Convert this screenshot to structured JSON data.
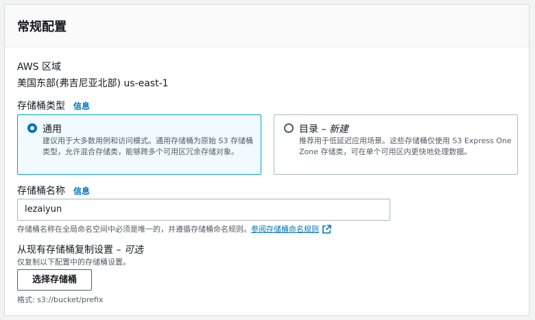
{
  "panel": {
    "title": "常规配置"
  },
  "region": {
    "label": "AWS 区域",
    "value": "美国东部(弗吉尼亚北部) us-east-1"
  },
  "bucket_type": {
    "label": "存储桶类型",
    "info": "信息",
    "options": [
      {
        "title": "通用",
        "title_suffix": "",
        "description": "建议用于大多数用例和访问模式。通用存储桶为原始 S3 存储桶类型，允许混合存储类，能够跨多个可用区冗余存储对象。",
        "selected": true
      },
      {
        "title": "目录 – ",
        "title_suffix": "新建",
        "description": "推荐用于低延迟应用场景。这些存储桶仅使用 S3 Express One Zone 存储类，可在单个可用区内更快地处理数据。",
        "selected": false
      }
    ]
  },
  "bucket_name": {
    "label": "存储桶名称",
    "info": "信息",
    "value": "lezaiyun",
    "hint": "存储桶名称在全局命名空间中必须是唯一的，并遵循存储桶命名规则。",
    "hint_link": "参阅存储桶命名规则"
  },
  "copy_settings": {
    "label": "从现有存储桶复制设置 – ",
    "label_optional": "可选",
    "description": "仅复制以下配置中的存储桶设置。",
    "button": "选择存储桶",
    "format": "格式: s3://bucket/prefix"
  },
  "colors": {
    "accent": "#0073bb",
    "selected_bg": "#f1faff",
    "selected_border": "#00a1c9"
  }
}
